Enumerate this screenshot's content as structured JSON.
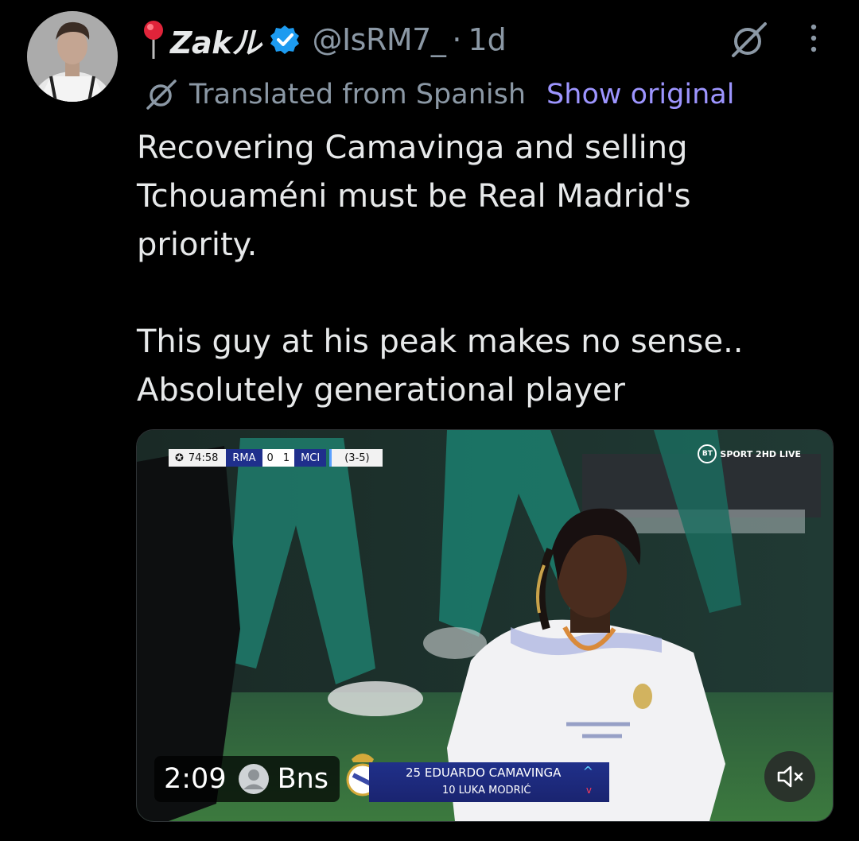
{
  "tweet": {
    "author": {
      "pin_emoji": "📍",
      "display_name": "Zakル",
      "verified": true,
      "handle": "@IsRM7_",
      "separator": "·",
      "timestamp": "1d"
    },
    "translation": {
      "label": "Translated from Spanish",
      "show_original": "Show original"
    },
    "text": {
      "paragraph1": "Recovering Camavinga and selling Tchouaméni must be Real Madrid's priority.",
      "paragraph2_line1": "This guy at his peak makes no sense..",
      "paragraph2_line2": "Absolutely generational player"
    },
    "media": {
      "scorebug": {
        "clock": "74:58",
        "home_team": "RMA",
        "home_score": "0",
        "away_score": "1",
        "away_team": "MCI",
        "aggregate": "(3-5)"
      },
      "broadcaster": {
        "logo_mark": "BT",
        "label": "SPORT 2HD LIVE"
      },
      "substitution": {
        "player_in": "25 EDUARDO CAMAVINGA",
        "player_out": "10 LUKA MODRIĆ",
        "in_icon": "^",
        "out_icon": "v"
      },
      "duration": "2:09",
      "uploader": "Bns",
      "mute_icon": "speaker-muted-icon"
    }
  },
  "colors": {
    "background": "#000000",
    "primary_text": "#e7e9ea",
    "secondary_text": "#8b98a5",
    "link": "#9d95ff",
    "verified_badge": "#1d9bf0"
  }
}
